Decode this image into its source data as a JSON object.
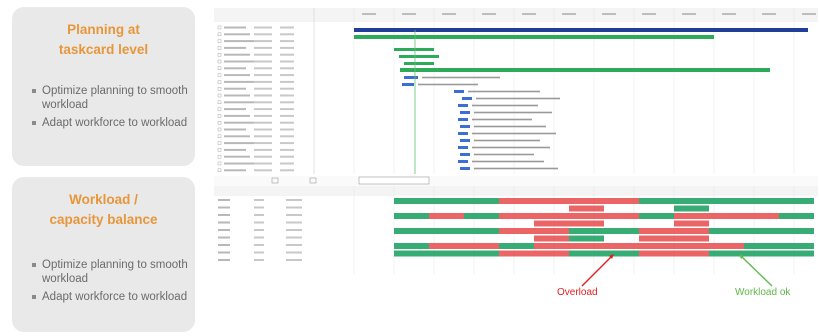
{
  "cards": [
    {
      "title_line1": "Planning at",
      "title_line2": "taskcard level",
      "bullets": [
        "Optimize planning to smooth workload",
        "Adapt workforce to workload"
      ]
    },
    {
      "title_line1": "Workload /",
      "title_line2": "capacity balance",
      "bullets": [
        "Optimize planning to smooth workload",
        "Adapt workforce to workload"
      ]
    }
  ],
  "annotations": {
    "overload": "Overload",
    "workload_ok": "Workload ok"
  },
  "colors": {
    "accent": "#e8963a",
    "overload_red": "#e95457",
    "ok_green": "#21a366",
    "gantt_green": "#2faa5b",
    "gantt_blue": "#3b6fd6",
    "gantt_navy": "#1f3f9a"
  }
}
